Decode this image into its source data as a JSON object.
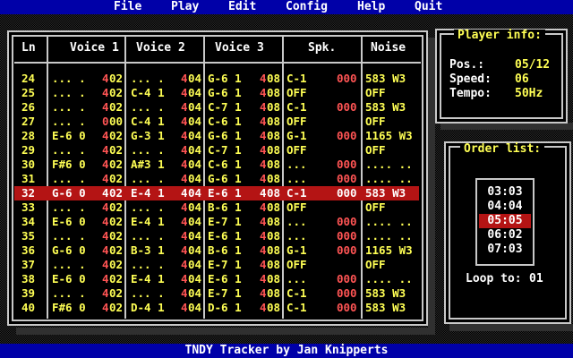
{
  "menu": [
    "File",
    "Play",
    "Edit",
    "Config",
    "Help",
    "Quit"
  ],
  "columns": [
    "Ln",
    "Voice 1",
    "Voice 2",
    "Voice 3",
    "Spk.",
    "Noise"
  ],
  "rows": [
    {
      "ln": "24",
      "v1": "... .",
      "v1i": "4",
      "v1v": "02",
      "v2": "... .",
      "v2i": "4",
      "v2v": "04",
      "v3": "G-6 1",
      "v3i": "4",
      "v3v": "08",
      "sp": "C-1",
      "spv": "000",
      "nz": "583 W3"
    },
    {
      "ln": "25",
      "v1": "... .",
      "v1i": "4",
      "v1v": "02",
      "v2": "C-4 1",
      "v2i": "4",
      "v2v": "04",
      "v3": "G-6 1",
      "v3i": "4",
      "v3v": "08",
      "sp": "OFF",
      "spv": "",
      "nz": "OFF"
    },
    {
      "ln": "26",
      "v1": "... .",
      "v1i": "4",
      "v1v": "02",
      "v2": "... .",
      "v2i": "4",
      "v2v": "04",
      "v3": "C-7 1",
      "v3i": "4",
      "v3v": "08",
      "sp": "C-1",
      "spv": "000",
      "nz": "583 W3"
    },
    {
      "ln": "27",
      "v1": "... .",
      "v1i": "0",
      "v1v": "00",
      "v2": "C-4 1",
      "v2i": "4",
      "v2v": "04",
      "v3": "C-6 1",
      "v3i": "4",
      "v3v": "08",
      "sp": "OFF",
      "spv": "",
      "nz": "OFF"
    },
    {
      "ln": "28",
      "v1": "E-6 0",
      "v1i": "4",
      "v1v": "02",
      "v2": "G-3 1",
      "v2i": "4",
      "v2v": "04",
      "v3": "G-6 1",
      "v3i": "4",
      "v3v": "08",
      "sp": "G-1",
      "spv": "000",
      "nz": "1165 W3"
    },
    {
      "ln": "29",
      "v1": "... .",
      "v1i": "4",
      "v1v": "02",
      "v2": "... .",
      "v2i": "4",
      "v2v": "04",
      "v3": "C-7 1",
      "v3i": "4",
      "v3v": "08",
      "sp": "OFF",
      "spv": "",
      "nz": "OFF"
    },
    {
      "ln": "30",
      "v1": "F#6 0",
      "v1i": "4",
      "v1v": "02",
      "v2": "A#3 1",
      "v2i": "4",
      "v2v": "04",
      "v3": "C-6 1",
      "v3i": "4",
      "v3v": "08",
      "sp": "...",
      "spv": "000",
      "nz": ".... .."
    },
    {
      "ln": "31",
      "v1": "... .",
      "v1i": "4",
      "v1v": "02",
      "v2": "... .",
      "v2i": "4",
      "v2v": "04",
      "v3": "G-6 1",
      "v3i": "4",
      "v3v": "08",
      "sp": "...",
      "spv": "000",
      "nz": ".... .."
    },
    {
      "ln": "32",
      "v1": "G-6 0",
      "v1i": "4",
      "v1v": "02",
      "v2": "E-4 1",
      "v2i": "4",
      "v2v": "04",
      "v3": "E-6 1",
      "v3i": "4",
      "v3v": "08",
      "sp": "C-1",
      "spv": "000",
      "nz": "583 W3",
      "current": true
    },
    {
      "ln": "33",
      "v1": "... .",
      "v1i": "4",
      "v1v": "02",
      "v2": "... .",
      "v2i": "4",
      "v2v": "04",
      "v3": "B-6 1",
      "v3i": "4",
      "v3v": "08",
      "sp": "OFF",
      "spv": "",
      "nz": "OFF"
    },
    {
      "ln": "34",
      "v1": "E-6 0",
      "v1i": "4",
      "v1v": "02",
      "v2": "E-4 1",
      "v2i": "4",
      "v2v": "04",
      "v3": "E-7 1",
      "v3i": "4",
      "v3v": "08",
      "sp": "...",
      "spv": "000",
      "nz": ".... .."
    },
    {
      "ln": "35",
      "v1": "... .",
      "v1i": "4",
      "v1v": "02",
      "v2": "... .",
      "v2i": "4",
      "v2v": "04",
      "v3": "E-6 1",
      "v3i": "4",
      "v3v": "08",
      "sp": "...",
      "spv": "000",
      "nz": ".... .."
    },
    {
      "ln": "36",
      "v1": "G-6 0",
      "v1i": "4",
      "v1v": "02",
      "v2": "B-3 1",
      "v2i": "4",
      "v2v": "04",
      "v3": "B-6 1",
      "v3i": "4",
      "v3v": "08",
      "sp": "G-1",
      "spv": "000",
      "nz": "1165 W3"
    },
    {
      "ln": "37",
      "v1": "... .",
      "v1i": "4",
      "v1v": "02",
      "v2": "... .",
      "v2i": "4",
      "v2v": "04",
      "v3": "E-7 1",
      "v3i": "4",
      "v3v": "08",
      "sp": "OFF",
      "spv": "",
      "nz": "OFF"
    },
    {
      "ln": "38",
      "v1": "E-6 0",
      "v1i": "4",
      "v1v": "02",
      "v2": "E-4 1",
      "v2i": "4",
      "v2v": "04",
      "v3": "E-6 1",
      "v3i": "4",
      "v3v": "08",
      "sp": "...",
      "spv": "000",
      "nz": ".... .."
    },
    {
      "ln": "39",
      "v1": "... .",
      "v1i": "4",
      "v1v": "02",
      "v2": "... .",
      "v2i": "4",
      "v2v": "04",
      "v3": "E-7 1",
      "v3i": "4",
      "v3v": "08",
      "sp": "C-1",
      "spv": "000",
      "nz": "583 W3"
    },
    {
      "ln": "40",
      "v1": "F#6 0",
      "v1i": "4",
      "v1v": "02",
      "v2": "D-4 1",
      "v2i": "4",
      "v2v": "04",
      "v3": "D-6 1",
      "v3i": "4",
      "v3v": "08",
      "sp": "C-1",
      "spv": "000",
      "nz": "583 W3"
    }
  ],
  "player_info": {
    "title": "Player info:",
    "pos_label": "Pos.:",
    "pos_value": "05/12",
    "speed_label": "Speed:",
    "speed_value": "06",
    "tempo_label": "Tempo:",
    "tempo_value": "50Hz"
  },
  "order_list": {
    "title": "Order list:",
    "items": [
      {
        "a": "03",
        "b": "03"
      },
      {
        "a": "04",
        "b": "04"
      },
      {
        "a": "05",
        "b": "05",
        "selected": true
      },
      {
        "a": "06",
        "b": "02"
      },
      {
        "a": "07",
        "b": "03"
      }
    ],
    "loop_label": "Loop to:",
    "loop_value": "01"
  },
  "status_text": "TNDY Tracker by Jan Knipperts",
  "colors": {
    "menu_bg": "#0000a8",
    "highlight": "#b41414",
    "note": "#ffff54",
    "volume": "#ff5454",
    "frame": "#c8c8c8"
  }
}
